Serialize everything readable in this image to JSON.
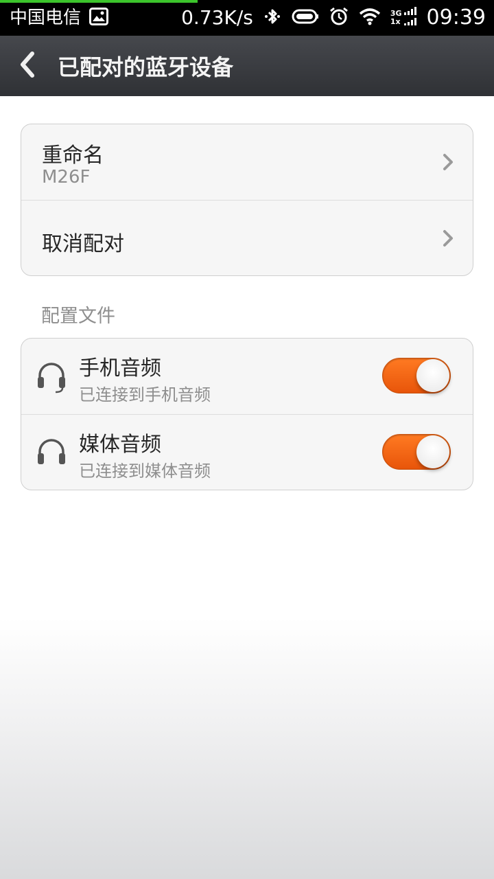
{
  "status_bar": {
    "carrier": "中国电信",
    "speed": "0.73K/s",
    "network_top": "3G",
    "network_bottom": "1x",
    "time": "09:39",
    "icons": [
      "image-icon",
      "bluetooth-icon",
      "battery-icon",
      "alarm-icon",
      "wifi-icon",
      "signal-icon"
    ]
  },
  "action_bar": {
    "title": "已配对的蓝牙设备",
    "back_icon": "chevron-left-icon"
  },
  "device_card": {
    "rename_label": "重命名",
    "device_name": "M26F",
    "unpair_label": "取消配对"
  },
  "profiles": {
    "section_label": "配置文件",
    "items": [
      {
        "title": "手机音频",
        "subtitle": "已连接到手机音频",
        "enabled": true,
        "icon": "headset-mic-icon"
      },
      {
        "title": "媒体音频",
        "subtitle": "已连接到媒体音频",
        "enabled": true,
        "icon": "headphones-icon"
      }
    ]
  },
  "colors": {
    "toggle_on": "#f26a1b",
    "action_bar": "#3a3c40",
    "progress_line": "#3cc42c"
  }
}
